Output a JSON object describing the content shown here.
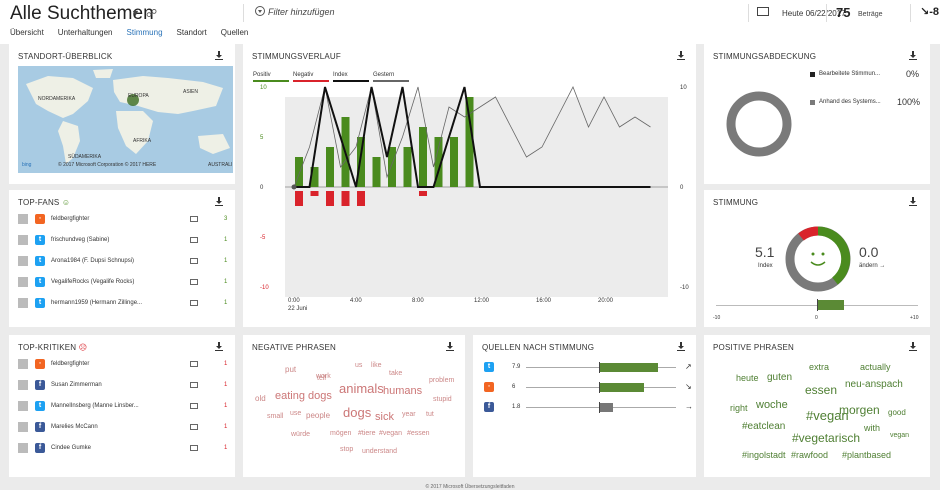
{
  "header": {
    "title": "Alle Suchthemen",
    "filter_placeholder": "Filter hinzufügen",
    "date_label": "Heute 06/22/2017",
    "count": "75",
    "count_label": "Beträge",
    "trend": "-8",
    "tabs": [
      "Übersicht",
      "Unterhaltungen",
      "Stimmung",
      "Standort",
      "Quellen"
    ],
    "active_tab": 2
  },
  "standort": {
    "title": "STANDORT-ÜBERBLICK",
    "labels": [
      "NORDAMERIKA",
      "EUROPA",
      "ASIEN",
      "AFRIKA",
      "SÜDAMERIKA",
      "AUSTRALI"
    ],
    "copyright": "© 2017 Microsoft Corporation © 2017 HERE",
    "bing": "bing"
  },
  "fans": {
    "title": "TOP-FANS",
    "rows": [
      {
        "name": "feldbergfighter",
        "src": "rss",
        "count": "3"
      },
      {
        "name": "frischundveg (Sabine)",
        "src": "twitter",
        "count": "1"
      },
      {
        "name": "Arona1984 (F. Dupsi Schnupsi)",
        "src": "twitter",
        "count": "1"
      },
      {
        "name": "VegalifeRocks (Vegalife Rocks)",
        "src": "twitter",
        "count": "1"
      },
      {
        "name": "hermann1959 (Hermann Zillinge...",
        "src": "twitter",
        "count": "1"
      }
    ]
  },
  "kritiken": {
    "title": "TOP-KRITIKEN",
    "rows": [
      {
        "name": "feldbergfighter",
        "src": "rss",
        "count": "1"
      },
      {
        "name": "Susan Zimmerman",
        "src": "facebook",
        "count": "1"
      },
      {
        "name": "MannelInsberg (Manne Linsber...",
        "src": "twitter",
        "count": "1"
      },
      {
        "name": "Marelies McCann",
        "src": "facebook",
        "count": "1"
      },
      {
        "name": "Cindee Gumke",
        "src": "facebook",
        "count": "1"
      }
    ]
  },
  "verlauf": {
    "title": "STIMMUNGSVERLAUF",
    "legend": [
      "Positiv",
      "Negativ",
      "Index",
      "Gestern"
    ],
    "yticks": [
      "10",
      "5",
      "0",
      "-5",
      "-10"
    ],
    "yticks_right": [
      "10",
      "0",
      "-10"
    ],
    "xticks": [
      "0:00",
      "4:00",
      "8:00",
      "12:00",
      "16:00",
      "20:00"
    ],
    "xsub": "22 Juni"
  },
  "abdeckung": {
    "title": "STIMMUNGSABDECKUNG",
    "items": [
      {
        "label": "Bearbeitete Stimmun...",
        "value": "0%"
      },
      {
        "label": "Anhand des Systems...",
        "value": "100%"
      }
    ]
  },
  "stimmung": {
    "title": "STIMMUNG",
    "index": "5.1",
    "index_label": "Index",
    "change": "0.0",
    "change_label": "ändern",
    "scale_min": "-10",
    "scale_mid": "0",
    "scale_max": "+10",
    "value": 5.1
  },
  "negative": {
    "title": "NEGATIVE PHRASEN",
    "words": [
      "put",
      "tell",
      "us",
      "like",
      "work",
      "take",
      "problem",
      "animals",
      "old",
      "eating dogs",
      "humans",
      "stupid",
      "small",
      "use",
      "people",
      "dogs",
      "sick",
      "year",
      "tut",
      "würde",
      "mögen",
      "#tiere",
      "#vegan",
      "#essen",
      "stop",
      "understand"
    ]
  },
  "quellen": {
    "title": "QUELLEN NACH STIMMUNG",
    "rows": [
      {
        "src": "twitter",
        "value": "7.9",
        "score": 7.9
      },
      {
        "src": "rss",
        "value": "6",
        "score": 6
      },
      {
        "src": "facebook",
        "value": "1.8",
        "score": 1.8
      }
    ]
  },
  "positive": {
    "title": "POSITIVE PHRASEN",
    "words": [
      "extra",
      "actually",
      "heute",
      "guten",
      "essen",
      "neu-anspach",
      "right",
      "woche",
      "#vegan",
      "morgen",
      "good",
      "#eatclean",
      "with",
      "#vegetarisch",
      "vegan",
      "#ingolstadt",
      "#rawfood",
      "#plantbased"
    ]
  },
  "footer": "© 2017 Microsoft    Übersetzungsleitfaden",
  "colors": {
    "positive": "#4a8b1e",
    "negative": "#d9232b",
    "accent": "#2a73b8",
    "grey": "#7a7a7a"
  },
  "chart_data": {
    "type": "bar",
    "title": "STIMMUNGSVERLAUF",
    "x_labels": [
      "0:00",
      "4:00",
      "8:00",
      "12:00",
      "16:00",
      "20:00"
    ],
    "ylim": [
      -10,
      10
    ],
    "series": [
      {
        "name": "Positiv",
        "values": [
          3,
          2,
          4,
          7,
          5,
          3,
          4,
          4,
          6,
          5,
          5,
          9
        ]
      },
      {
        "name": "Negativ",
        "values": [
          -3,
          -1,
          -3,
          -3,
          -3,
          0,
          0,
          0,
          -1,
          0,
          0,
          0
        ]
      },
      {
        "name": "Index",
        "values": [
          0,
          0,
          10,
          5,
          0,
          10,
          3,
          10,
          0,
          0,
          5,
          10,
          0,
          0,
          0,
          0,
          0,
          0,
          0,
          0,
          0,
          0,
          0,
          0
        ]
      },
      {
        "name": "Gestern",
        "values": [
          0,
          4,
          10,
          2,
          4,
          10,
          1,
          5,
          10,
          2,
          8,
          7,
          8,
          9,
          6,
          3,
          4,
          7,
          10,
          6,
          9,
          6,
          7,
          6
        ]
      }
    ]
  }
}
